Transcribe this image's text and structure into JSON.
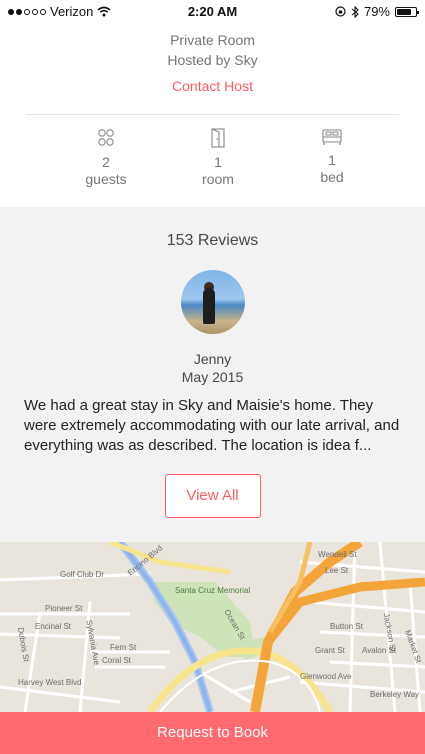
{
  "status_bar": {
    "carrier": "Verizon",
    "time": "2:20 AM",
    "battery": "79%",
    "battery_level": 0.79
  },
  "listing": {
    "room_type": "Private Room",
    "hosted_by": "Hosted by Sky",
    "contact_label": "Contact Host"
  },
  "amenities": [
    {
      "icon": "guests-icon",
      "count": "2",
      "label": "guests"
    },
    {
      "icon": "door-icon",
      "count": "1",
      "label": "room"
    },
    {
      "icon": "bed-icon",
      "count": "1",
      "label": "bed"
    }
  ],
  "reviews": {
    "title": "153 Reviews",
    "reviewer": "Jenny",
    "date": "May 2015",
    "text": "We had a great stay in Sky and Maisie's home. They were extremely accommodating with our late arrival, and everything was as described. The location is idea f...",
    "view_all_label": "View All"
  },
  "map": {
    "labels": [
      "Golf Club Dr",
      "Santa Cruz Memorial",
      "Pioneer St",
      "Encinal St",
      "Fern St",
      "Coral St",
      "Harvey West Blvd",
      "Dubois St",
      "Sylvania Ave",
      "Ocean St",
      "Wendell St",
      "Lee St",
      "Button St",
      "Jackson St",
      "Grant St",
      "Avalon St",
      "Glenwood Ave",
      "Berkeley Way",
      "Market St",
      "Encino Blvd"
    ]
  },
  "actions": {
    "book_label": "Request to Book"
  }
}
